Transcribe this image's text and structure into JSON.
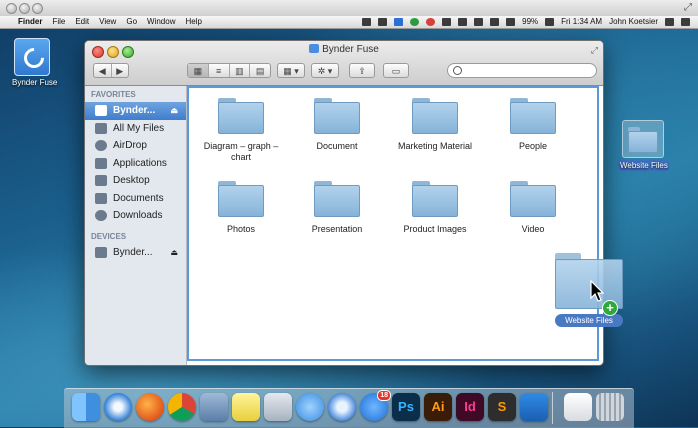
{
  "menubar": {
    "apple": "",
    "items": [
      "Finder",
      "File",
      "Edit",
      "View",
      "Go",
      "Window",
      "Help"
    ],
    "battery": "99%",
    "clock": "Fri 1:34 AM",
    "user": "John Koetsier"
  },
  "desktop": {
    "bynder_label": "Bynder Fuse",
    "website_files_label": "Website Files"
  },
  "window": {
    "title": "Bynder Fuse",
    "search_placeholder": ""
  },
  "sidebar": {
    "favorites_header": "FAVORITES",
    "favorites": [
      "Bynder...",
      "All My Files",
      "AirDrop",
      "Applications",
      "Desktop",
      "Documents",
      "Downloads"
    ],
    "devices_header": "DEVICES",
    "devices": [
      "Bynder..."
    ]
  },
  "folders": [
    "Diagram – graph – chart",
    "Document",
    "Marketing Material",
    "People",
    "Photos",
    "Presentation",
    "Product Images",
    "Video"
  ],
  "drag": {
    "label": "Website Files",
    "plus": "+"
  },
  "dock": {
    "apps": [
      "finder",
      "safari",
      "firefox",
      "chrome",
      "mail",
      "stickies",
      "preview",
      "messages",
      "itunes",
      "app-store",
      "photoshop",
      "illustrator",
      "indesign",
      "sublime",
      "visual-studio-code"
    ],
    "badge_count": "18",
    "ps": "Ps",
    "ai": "Ai",
    "id": "Id",
    "s": "S"
  }
}
